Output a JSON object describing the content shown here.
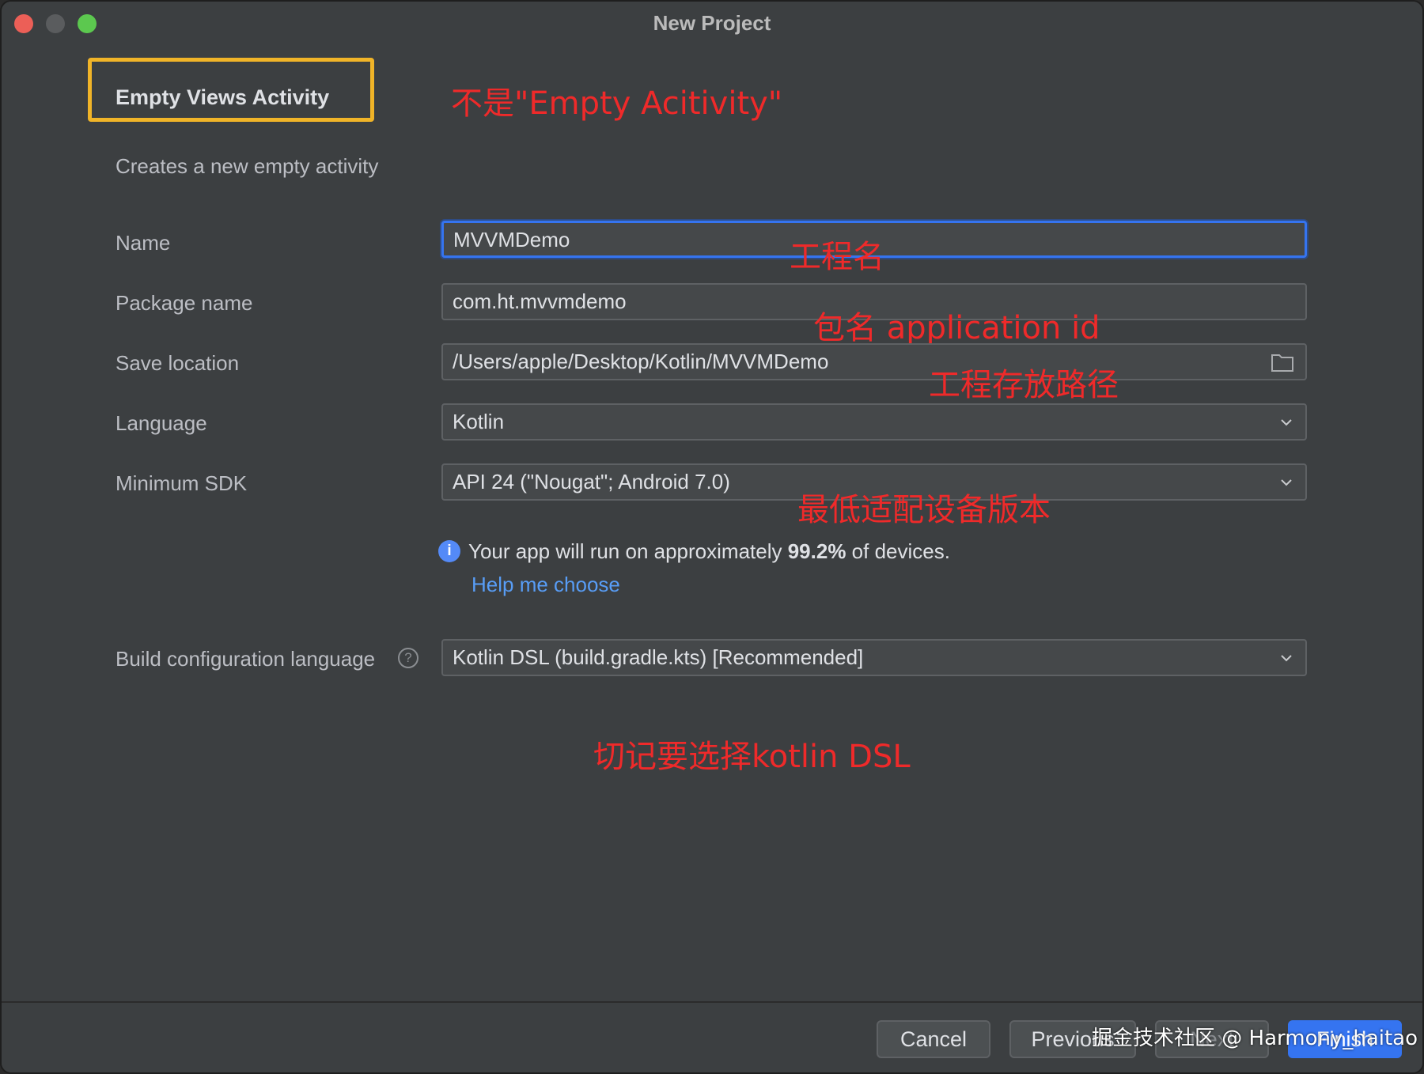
{
  "window": {
    "title": "New Project"
  },
  "template": {
    "name": "Empty Views Activity",
    "description": "Creates a new empty activity"
  },
  "form": {
    "name": {
      "label": "Name",
      "value": "MVVMDemo"
    },
    "package": {
      "label": "Package name",
      "value": "com.ht.mvvmdemo"
    },
    "save_location": {
      "label": "Save location",
      "value": "/Users/apple/Desktop/Kotlin/MVVMDemo"
    },
    "language": {
      "label": "Language",
      "value": "Kotlin"
    },
    "min_sdk": {
      "label": "Minimum SDK",
      "value": "API 24 (\"Nougat\"; Android 7.0)"
    },
    "build_config": {
      "label": "Build configuration language",
      "value": "Kotlin DSL (build.gradle.kts) [Recommended]"
    }
  },
  "info": {
    "prefix": "Your app will run on approximately ",
    "percent": "99.2%",
    "suffix": " of devices.",
    "help_link": "Help me choose"
  },
  "annotations": {
    "template_note": "不是\"Empty Acitivity\"",
    "name_note": "工程名",
    "package_note": "包名 application id",
    "location_note": "工程存放路径",
    "sdk_note": "最低适配设备版本",
    "dsl_note": "切记要选择kotlin DSL"
  },
  "buttons": {
    "cancel": "Cancel",
    "previous": "Previous",
    "next": "Next",
    "finish": "Finish"
  },
  "watermark": "掘金技术社区 @ Harmony_haitao",
  "colors": {
    "accent": "#3574f0",
    "highlight_box": "#f0b428",
    "annotation": "#ef2a2a",
    "link": "#589df6"
  }
}
